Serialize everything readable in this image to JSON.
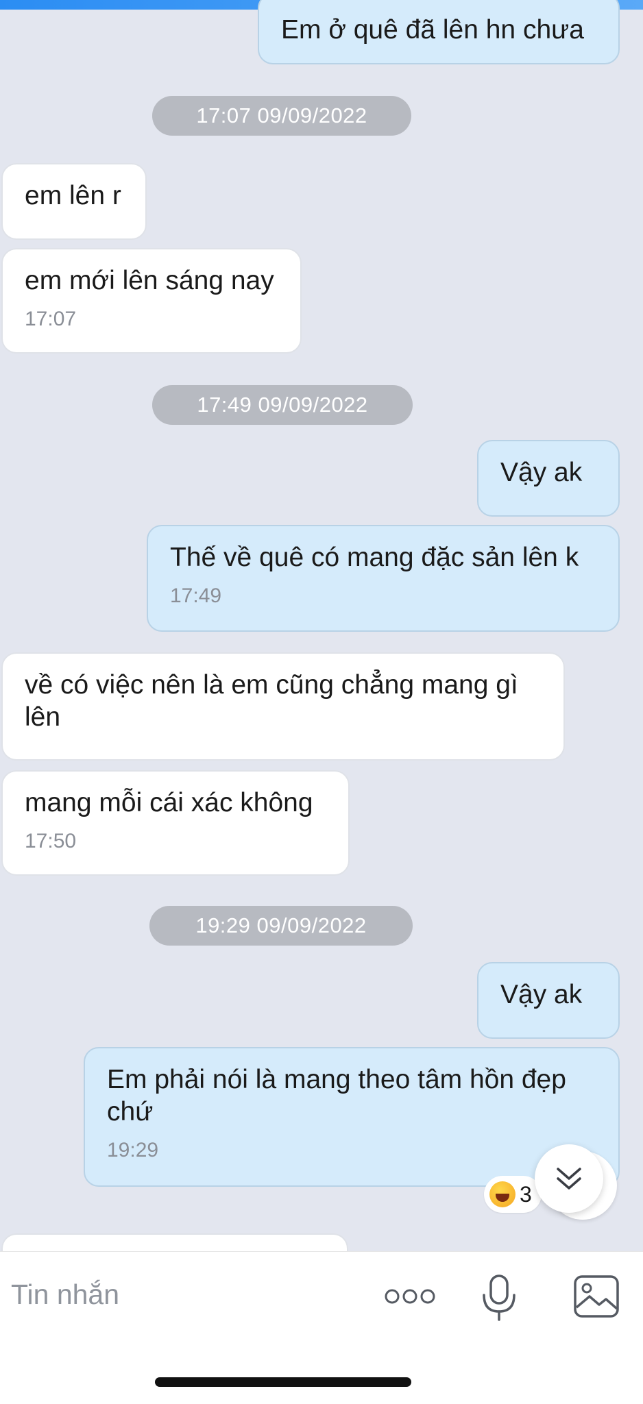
{
  "messages": [
    {
      "text": "Em ở  quê đã lên hn chưa"
    },
    {
      "text": "em lên r"
    },
    {
      "text": "em mới lên sáng nay",
      "time": "17:07"
    },
    {
      "text": "Vậy ak"
    },
    {
      "text": "Thế về quê có mang đặc sản lên k",
      "time": "17:49"
    },
    {
      "text": "về có việc nên là em cũng chẳng mang gì lên"
    },
    {
      "text": "mang mỗi cái xác không",
      "time": "17:50"
    },
    {
      "text": "Vậy ak"
    },
    {
      "text": "Em phải nói là mang theo tâm hồn đẹp chứ",
      "time": "19:29"
    }
  ],
  "date_separators": [
    "17:07 09/09/2022",
    "17:49 09/09/2022",
    "19:29 09/09/2022"
  ],
  "reaction": {
    "emoji": "laughing-face-icon",
    "count": "3"
  },
  "composer": {
    "placeholder": "Tin nhắn"
  },
  "colors": {
    "background": "#e3e6ef",
    "incoming_bubble": "#ffffff",
    "outgoing_bubble": "#d5ebfb",
    "date_pill": "#b7bac1"
  }
}
